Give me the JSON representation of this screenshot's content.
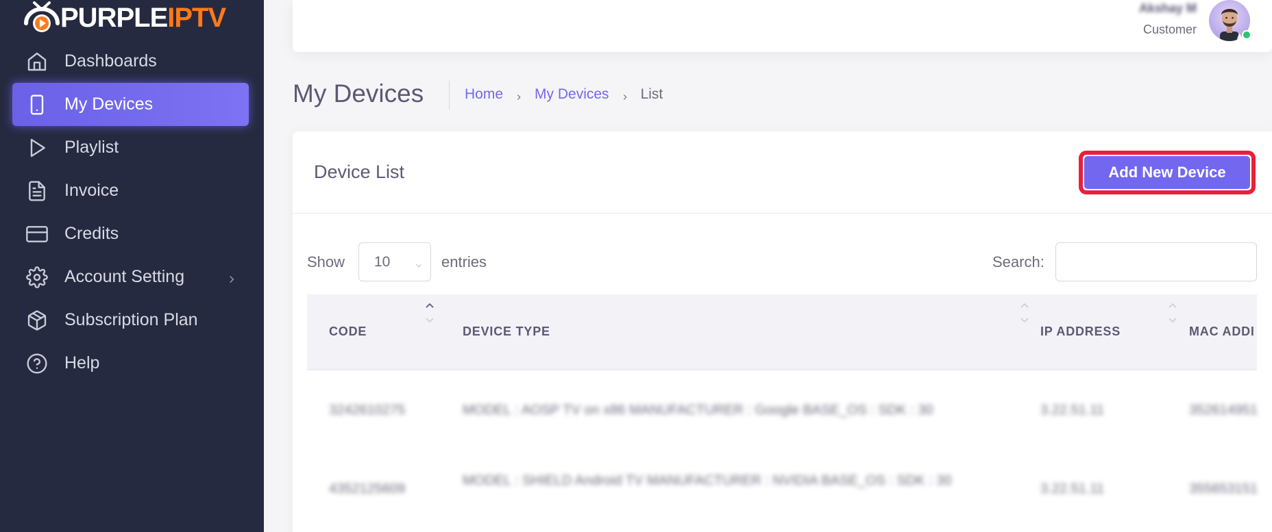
{
  "brand": {
    "word1": "PURPLE",
    "word2": "IPTV",
    "accent": "#ff7a1a"
  },
  "sidebar": {
    "items": [
      {
        "label": "Dashboards",
        "icon": "home-icon"
      },
      {
        "label": "My Devices",
        "icon": "smartphone-icon",
        "active": true
      },
      {
        "label": "Playlist",
        "icon": "play-icon"
      },
      {
        "label": "Invoice",
        "icon": "file-text-icon"
      },
      {
        "label": "Credits",
        "icon": "credit-card-icon"
      },
      {
        "label": "Account Setting",
        "icon": "gear-icon",
        "has_submenu": true
      },
      {
        "label": "Subscription Plan",
        "icon": "package-icon"
      },
      {
        "label": "Help",
        "icon": "help-circle-icon"
      }
    ]
  },
  "header": {
    "user_name": "Akshay M",
    "user_role": "Customer",
    "status_color": "#28c76f"
  },
  "page": {
    "title": "My Devices",
    "breadcrumb": [
      "Home",
      "My Devices",
      "List"
    ]
  },
  "card": {
    "title": "Device List",
    "add_button": "Add New Device",
    "highlight_color": "#ea1f3c"
  },
  "table_controls": {
    "show_label": "Show",
    "page_size": "10",
    "entries_label": "entries",
    "search_label": "Search:",
    "search_value": ""
  },
  "table": {
    "columns": [
      "CODE",
      "DEVICE TYPE",
      "IP ADDRESS",
      "MAC ADDI"
    ],
    "rows": [
      {
        "code": "3242610275",
        "device_type": "MODEL : AOSP TV on x86 MANUFACTURER : Google BASE_OS : SDK : 30",
        "ip": "3.22.51.11",
        "mac": "352614951"
      },
      {
        "code": "4352125609",
        "device_type": "MODEL : SHIELD Android TV MANUFACTURER : NVIDIA BASE_OS : SDK : 30",
        "ip": "3.22.51.11",
        "mac": "355653151"
      }
    ]
  },
  "colors": {
    "primary": "#7367f0",
    "sidebar_bg": "#262a40"
  }
}
